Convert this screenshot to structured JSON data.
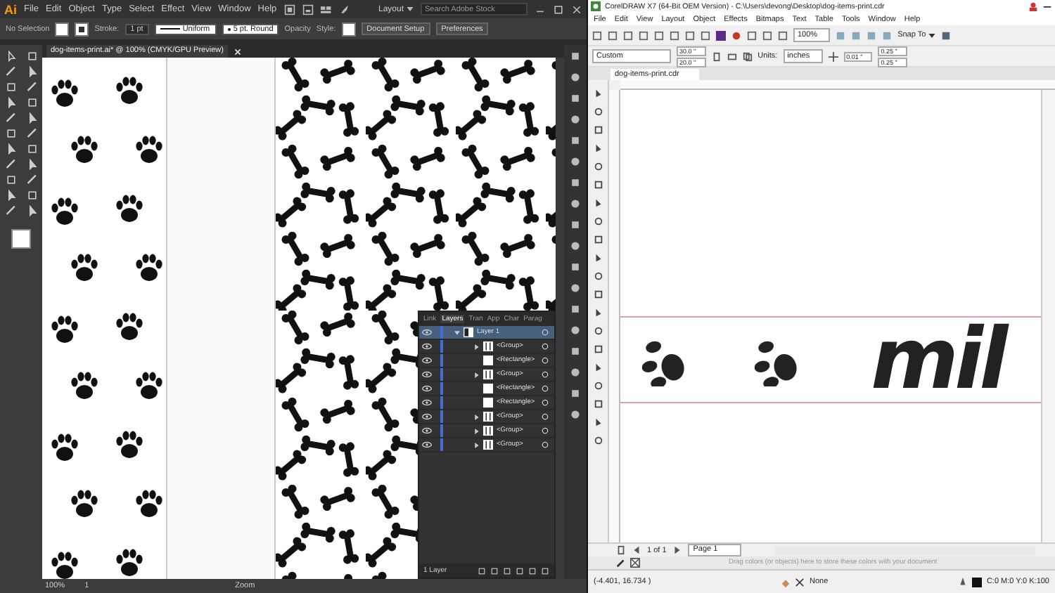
{
  "illustrator": {
    "logo": "Ai",
    "menu": [
      "File",
      "Edit",
      "Object",
      "Type",
      "Select",
      "Effect",
      "View",
      "Window",
      "Help"
    ],
    "workspace": "Layout",
    "search": {
      "placeholder": "Search Adobe Stock"
    },
    "control_bar": {
      "selection": "No Selection",
      "stroke_label": "Stroke:",
      "stroke_weight": "1 pt",
      "stroke_profile": "Uniform",
      "brush": "5 pt. Round",
      "opacity_label": "Opacity",
      "style_label": "Style:",
      "buttons": [
        "Document Setup",
        "Preferences"
      ]
    },
    "document_tab": "dog-items-print.ai* @ 100% (CMYK/GPU Preview)",
    "layers_panel": {
      "tabs": [
        {
          "label": "Link",
          "selected": false
        },
        {
          "label": "Layers",
          "selected": true
        },
        {
          "label": "Tran",
          "selected": false
        },
        {
          "label": "App",
          "selected": false
        },
        {
          "label": "Char",
          "selected": false
        },
        {
          "label": "Parag",
          "selected": false
        }
      ],
      "layers": [
        {
          "name": "Layer 1",
          "kind": "layer",
          "selected": true,
          "expanded": true,
          "children": [
            {
              "name": "<Group>",
              "kind": "group",
              "selected": false,
              "expanded": false
            },
            {
              "name": "<Rectangle>",
              "kind": "rectangle",
              "selected": false
            },
            {
              "name": "<Group>",
              "kind": "group",
              "selected": false,
              "expanded": false
            },
            {
              "name": "<Rectangle>",
              "kind": "rectangle",
              "selected": false
            },
            {
              "name": "<Rectangle>",
              "kind": "rectangle",
              "selected": false
            },
            {
              "name": "<Group>",
              "kind": "group",
              "selected": false,
              "expanded": false
            },
            {
              "name": "<Group>",
              "kind": "group",
              "selected": false,
              "expanded": false
            },
            {
              "name": "<Group>",
              "kind": "group",
              "selected": false,
              "expanded": false
            }
          ]
        }
      ],
      "footer": "1 Layer"
    },
    "status_bar": {
      "zoom": "100%",
      "artboard": "1",
      "tool": "Zoom"
    }
  },
  "coreldraw": {
    "title": "CorelDRAW X7 (64-Bit OEM Version) - C:\\Users\\devong\\Desktop\\dog-items-print.cdr",
    "menu": [
      "File",
      "Edit",
      "View",
      "Layout",
      "Object",
      "Effects",
      "Bitmaps",
      "Text",
      "Table",
      "Tools",
      "Window",
      "Help"
    ],
    "zoom": "100%",
    "snap": "Snap To",
    "property_bar": {
      "page_size": "Custom",
      "width": "30.0 \"",
      "height": "20.0 \"",
      "units_label": "Units:",
      "units": "inches",
      "nudge": "0.01 \"",
      "duplicate_x": "0.25 \"",
      "duplicate_y": "0.25 \""
    },
    "document_tab": "dog-items-print.cdr",
    "artwork_text": "mil",
    "page_nav": {
      "position": "1 of 1",
      "page_tab": "Page 1"
    },
    "color_docker_hint": "Drag colors (or objects) here to store these colors with your document",
    "status_bar": {
      "cursor": "(-4.401, 16.734 )",
      "fill": "None",
      "outline": "C:0 M:0 Y:0 K:100"
    }
  }
}
